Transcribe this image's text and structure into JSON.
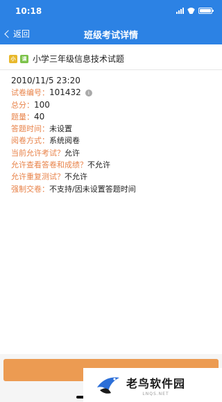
{
  "status_bar": {
    "time": "10:18"
  },
  "nav": {
    "back_label": "返回",
    "title": "班级考试详情"
  },
  "exam": {
    "tags": [
      "小",
      "课"
    ],
    "title": "小学三年级信息技术试题",
    "datetime": "2010/11/5 23:20",
    "fields": [
      {
        "label": "试卷编号：",
        "value": "101432"
      },
      {
        "label": "总分：",
        "value": "100"
      },
      {
        "label": "题量：",
        "value": "40"
      },
      {
        "label": "答题时间：",
        "value": "未设置"
      },
      {
        "label": "阅卷方式：",
        "value": "系统阅卷"
      },
      {
        "label": "当前允许考试？",
        "value": "允许"
      },
      {
        "label": "允许查看答卷和成绩？",
        "value": "不允许"
      },
      {
        "label": "允许重复测试？",
        "value": "不允许"
      },
      {
        "label": "强制交卷：",
        "value": "不支持/因未设置答题时间"
      }
    ]
  },
  "footer": {
    "button_label": ""
  },
  "watermark": {
    "name": "老鸟软件园",
    "sub": "LNQS.NET"
  },
  "colors": {
    "brand_blue": "#2c82e4",
    "label_orange": "#e8834a",
    "button_orange": "#ec9b52"
  },
  "icons": [
    "back-chevron-icon",
    "info-icon",
    "signal-icon",
    "wifi-icon",
    "battery-icon",
    "bird-logo-icon"
  ]
}
